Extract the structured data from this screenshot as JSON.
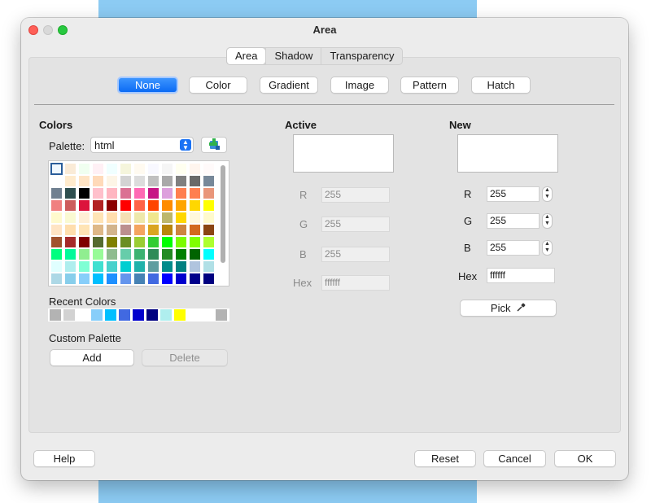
{
  "window": {
    "title": "Area"
  },
  "tabs": [
    "Area",
    "Shadow",
    "Transparency"
  ],
  "fill_types": [
    "None",
    "Color",
    "Gradient",
    "Image",
    "Pattern",
    "Hatch"
  ],
  "colors": {
    "heading": "Colors",
    "palette_label": "Palette:",
    "palette_value": "html",
    "swatches": [
      "#f0f8ff",
      "#faebd7",
      "#f0fff0",
      "#fff0f5",
      "#f0ffff",
      "#f5f5dc",
      "#fffaf0",
      "#f8f8ff",
      "#f5f5f5",
      "#fffff0",
      "#fff5ee",
      "#fffafa",
      "#ffffff",
      "#ffebcd",
      "#ffe4c4",
      "#ffdab9",
      "#fdf5e6",
      "#d3d3d3",
      "#dcdcdc",
      "#c0c0c0",
      "#a9a9a9",
      "#808080",
      "#696969",
      "#778899",
      "#708090",
      "#2f4f4f",
      "#000000",
      "#ffc0cb",
      "#ffb6c1",
      "#db7093",
      "#ff69b4",
      "#c71585",
      "#dda0dd",
      "#ff7f50",
      "#ff7f50",
      "#e9967a",
      "#f08080",
      "#cd5c5c",
      "#dc143c",
      "#b22222",
      "#8b0000",
      "#ff0000",
      "#ff6347",
      "#ff4500",
      "#ff8c00",
      "#ffa500",
      "#ffd700",
      "#ffff00",
      "#fffacd",
      "#fafad2",
      "#ffefd5",
      "#ffe4b5",
      "#ffdead",
      "#f5deb3",
      "#eee8aa",
      "#f0e68c",
      "#bdb76b",
      "#ffd700",
      "#fff8dc",
      "#fffacd",
      "#ffe4c4",
      "#ffdead",
      "#ffe4b5",
      "#deb887",
      "#d2b48c",
      "#bc8f8f",
      "#f4a460",
      "#daa520",
      "#b8860b",
      "#cd853f",
      "#d2691e",
      "#8b4513",
      "#a0522d",
      "#a52a2a",
      "#800000",
      "#556b2f",
      "#808000",
      "#6b8e23",
      "#9acd32",
      "#32cd32",
      "#00ff00",
      "#7cfc00",
      "#7fff00",
      "#adff2f",
      "#00ff7f",
      "#00fa9a",
      "#90ee90",
      "#98fb98",
      "#8fbc8f",
      "#66cdaa",
      "#3cb371",
      "#2e8b57",
      "#228b22",
      "#008000",
      "#006400",
      "#00ffff",
      "#e0ffff",
      "#afeeee",
      "#7fffd4",
      "#40e0d0",
      "#48d1cc",
      "#00ced1",
      "#20b2aa",
      "#5f9ea0",
      "#008b8b",
      "#008080",
      "#b0c4de",
      "#b0e0e6",
      "#add8e6",
      "#87ceeb",
      "#87cefa",
      "#00bfff",
      "#1e90ff",
      "#6495ed",
      "#4682b4",
      "#4169e1",
      "#0000ff",
      "#0000cd",
      "#00008b",
      "#000080"
    ],
    "recent_label": "Recent Colors",
    "recent": [
      "#b3b3b3",
      "#d2d2d2",
      "#ffffff",
      "#87cefa",
      "#00bfff",
      "#4169e1",
      "#0000cd",
      "#000080",
      "#afeeee",
      "#ffff00",
      "#ffffff",
      "#ffffff",
      "#b3b3b3"
    ],
    "custom_label": "Custom Palette",
    "add_label": "Add",
    "delete_label": "Delete"
  },
  "active": {
    "heading": "Active",
    "r_label": "R",
    "r_value": "255",
    "g_label": "G",
    "g_value": "255",
    "b_label": "B",
    "b_value": "255",
    "hex_label": "Hex",
    "hex_value": "ffffff"
  },
  "new": {
    "heading": "New",
    "r_label": "R",
    "r_value": "255",
    "g_label": "G",
    "g_value": "255",
    "b_label": "B",
    "b_value": "255",
    "hex_label": "Hex",
    "hex_value": "ffffff",
    "pick_label": "Pick"
  },
  "footer": {
    "help": "Help",
    "reset": "Reset",
    "cancel": "Cancel",
    "ok": "OK"
  }
}
